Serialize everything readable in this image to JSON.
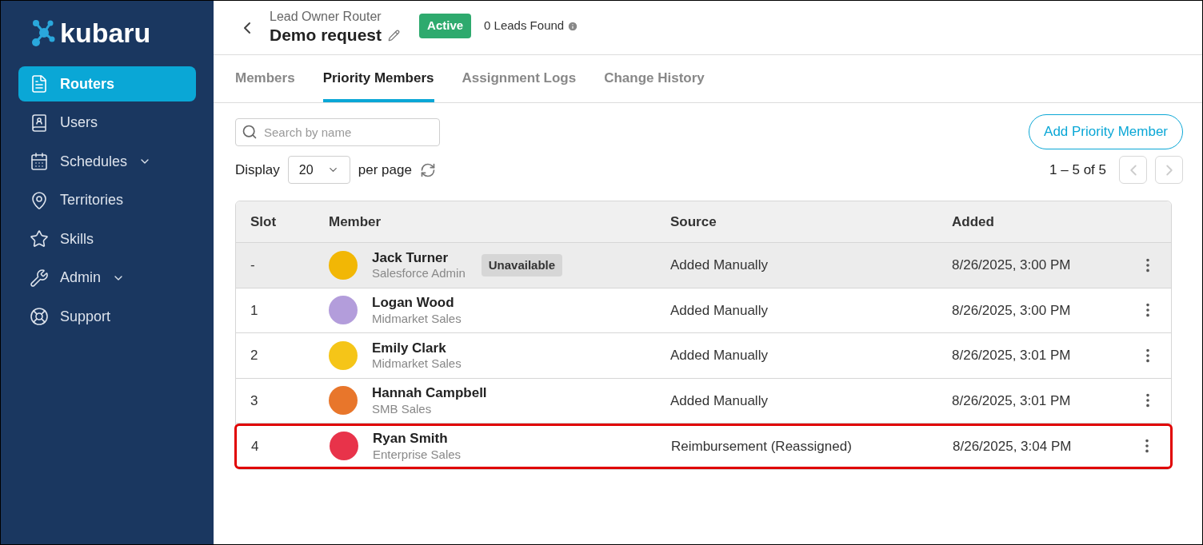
{
  "logo": {
    "text": "kubaru"
  },
  "sidebar": {
    "items": [
      {
        "label": "Routers",
        "selected": true,
        "expandable": false
      },
      {
        "label": "Users",
        "selected": false,
        "expandable": false
      },
      {
        "label": "Schedules",
        "selected": false,
        "expandable": true
      },
      {
        "label": "Territories",
        "selected": false,
        "expandable": false
      },
      {
        "label": "Skills",
        "selected": false,
        "expandable": false
      },
      {
        "label": "Admin",
        "selected": false,
        "expandable": true
      },
      {
        "label": "Support",
        "selected": false,
        "expandable": false
      }
    ]
  },
  "header": {
    "breadcrumb": "Lead Owner Router",
    "title": "Demo request",
    "status": "Active",
    "leads_found": "0 Leads Found"
  },
  "tabs": [
    {
      "label": "Members",
      "selected": false
    },
    {
      "label": "Priority Members",
      "selected": true
    },
    {
      "label": "Assignment Logs",
      "selected": false
    },
    {
      "label": "Change History",
      "selected": false
    }
  ],
  "search": {
    "placeholder": "Search by name"
  },
  "add_button": "Add Priority Member",
  "pagination": {
    "display_label": "Display",
    "page_size": "20",
    "per_page_label": "per page",
    "range": "1 – 5 of 5"
  },
  "table": {
    "columns": [
      "Slot",
      "Member",
      "Source",
      "Added"
    ],
    "rows": [
      {
        "slot": "-",
        "name": "Jack Turner",
        "role": "Salesforce Admin",
        "badge": "Unavailable",
        "unavailable": true,
        "highlighted": false,
        "color": "#f2b705",
        "source": "Added Manually",
        "added": "8/26/2025, 3:00 PM"
      },
      {
        "slot": "1",
        "name": "Logan Wood",
        "role": "Midmarket Sales",
        "unavailable": false,
        "highlighted": false,
        "color": "#b39ddb",
        "source": "Added Manually",
        "added": "8/26/2025, 3:00 PM"
      },
      {
        "slot": "2",
        "name": "Emily Clark",
        "role": "Midmarket Sales",
        "unavailable": false,
        "highlighted": false,
        "color": "#f5c518",
        "source": "Added Manually",
        "added": "8/26/2025, 3:01 PM"
      },
      {
        "slot": "3",
        "name": "Hannah Campbell",
        "role": "SMB Sales",
        "unavailable": false,
        "highlighted": false,
        "color": "#e8762b",
        "source": "Added Manually",
        "added": "8/26/2025, 3:01 PM"
      },
      {
        "slot": "4",
        "name": "Ryan Smith",
        "role": "Enterprise Sales",
        "unavailable": false,
        "highlighted": true,
        "color": "#e8334a",
        "source": "Reimbursement (Reassigned)",
        "added": "8/26/2025, 3:04 PM"
      }
    ]
  }
}
